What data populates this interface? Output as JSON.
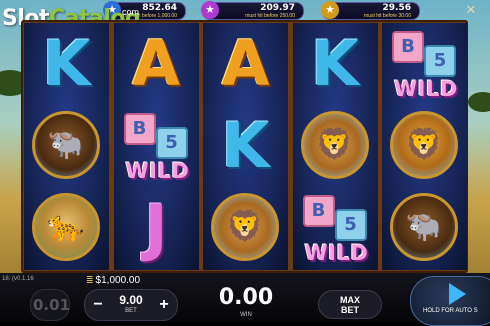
{
  "watermark": {
    "brand_prefix": "Slot",
    "brand_suffix": "Catalog",
    "tail": "com"
  },
  "jackpots": [
    {
      "value": "852.64",
      "caption": "must hit before 1,000.00",
      "color": "#2f6ed8"
    },
    {
      "value": "209.97",
      "caption": "must hit before 250.00",
      "color": "#b03ad0"
    },
    {
      "value": "29.56",
      "caption": "must hit before 30.00",
      "color": "#d49a1a"
    }
  ],
  "icons": {
    "close": "close-x-icon",
    "coin": "coin-stack-icon",
    "spin": "play-spin-icon"
  },
  "reels": [
    [
      {
        "type": "letter",
        "text": "K",
        "style": "K"
      },
      {
        "type": "animal",
        "animal": "buffalo"
      },
      {
        "type": "animal",
        "animal": "leopard"
      }
    ],
    [
      {
        "type": "letter",
        "text": "A",
        "style": "A"
      },
      {
        "type": "wild"
      },
      {
        "type": "letter",
        "text": "J",
        "style": "J"
      }
    ],
    [
      {
        "type": "letter",
        "text": "A",
        "style": "A"
      },
      {
        "type": "letter",
        "text": "K",
        "style": "K"
      },
      {
        "type": "animal",
        "animal": "cubs"
      }
    ],
    [
      {
        "type": "letter",
        "text": "K",
        "style": "K"
      },
      {
        "type": "animal",
        "animal": "cubs"
      },
      {
        "type": "wild"
      }
    ],
    [
      {
        "type": "wild"
      },
      {
        "type": "animal",
        "animal": "lion"
      },
      {
        "type": "animal",
        "animal": "buffalo"
      }
    ]
  ],
  "wild": {
    "block_b": "B",
    "block_5": "5",
    "word": "WILD"
  },
  "bottom": {
    "game_id": "18: (v0.1.16",
    "balance": "$1,000.00",
    "prev_value": "0.01",
    "bet_minus": "−",
    "bet_plus": "+",
    "bet_value": "9.00",
    "bet_label": "BET",
    "win_value": "0.00",
    "win_label": "WIN",
    "maxbet_line1": "MAX",
    "maxbet_line2": "BET",
    "spin_label": "HOLD FOR AUTO S"
  },
  "colors": {
    "frame": "#6a3a12",
    "reel_bg": "#14214f",
    "wild_pink": "#f7a0e0",
    "spin_blue": "#3fb7ff"
  }
}
